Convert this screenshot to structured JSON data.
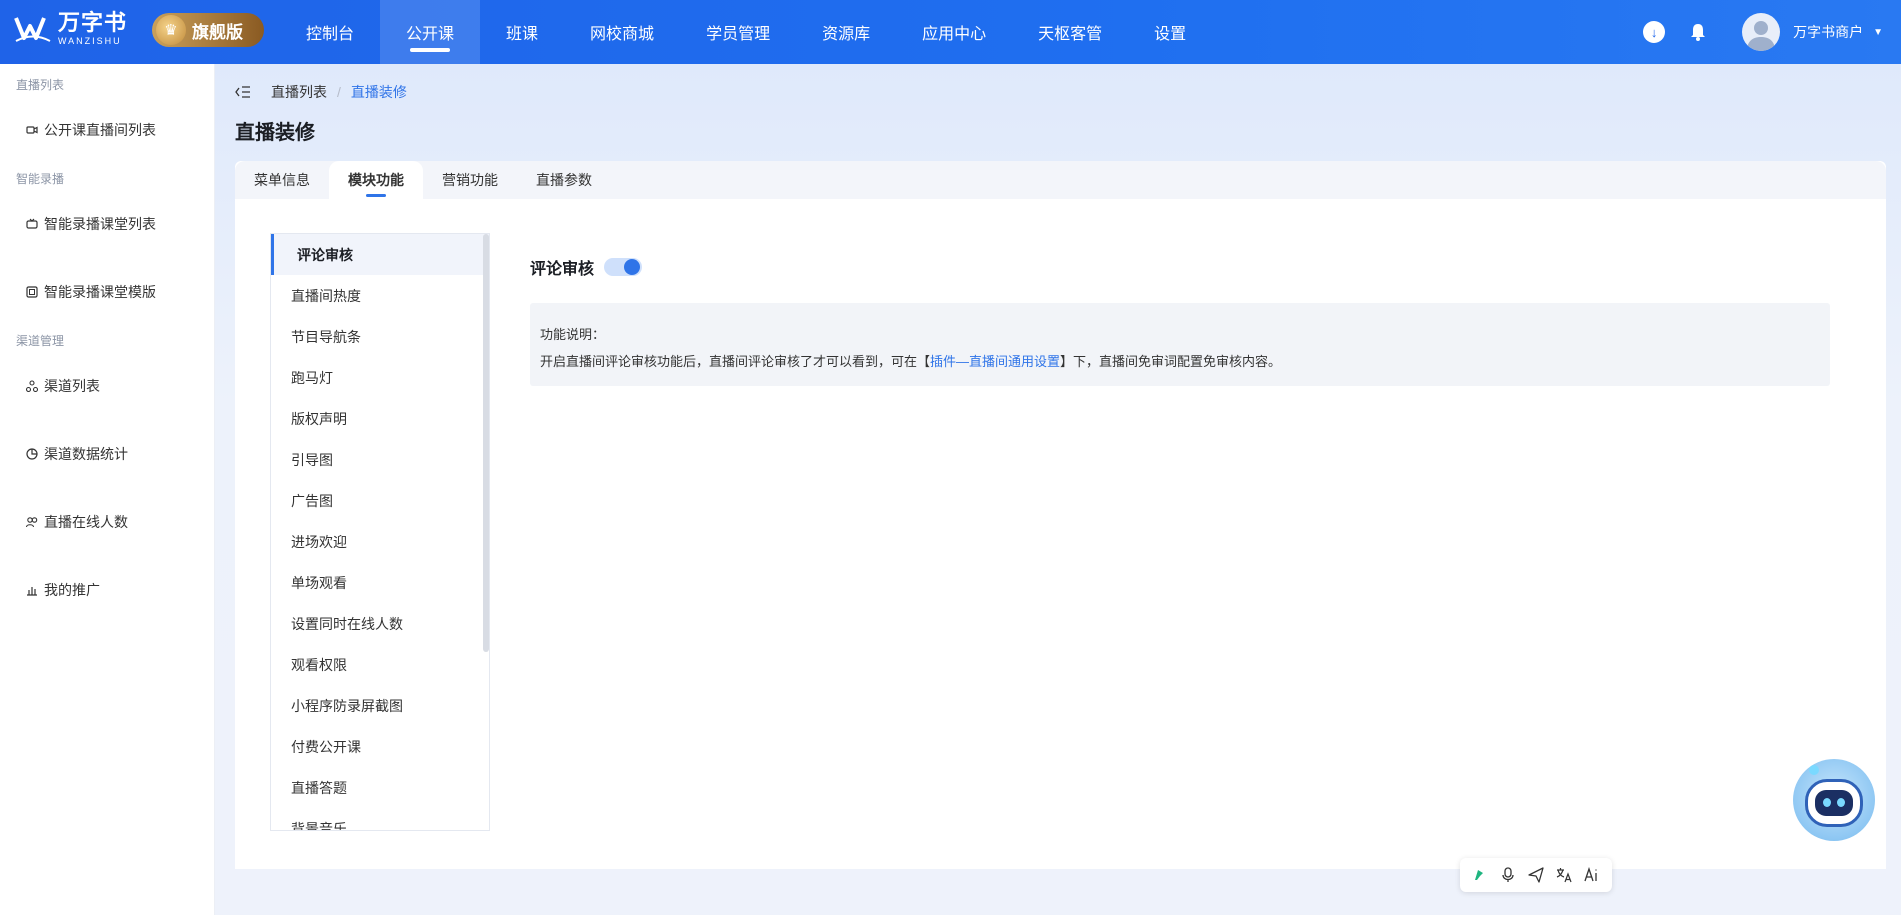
{
  "header": {
    "brand_cn": "万字书",
    "brand_en": "WANZISHU",
    "edition": "旗舰版",
    "nav": [
      {
        "label": "控制台"
      },
      {
        "label": "公开课",
        "active": true
      },
      {
        "label": "班课"
      },
      {
        "label": "网校商城"
      },
      {
        "label": "学员管理"
      },
      {
        "label": "资源库"
      },
      {
        "label": "应用中心"
      },
      {
        "label": "天枢客管"
      },
      {
        "label": "设置"
      }
    ],
    "user_name": "万字书商户"
  },
  "sidebar": {
    "groups": [
      {
        "title": "直播列表",
        "items": [
          {
            "label": "公开课直播间列表",
            "icon": "video-icon"
          }
        ]
      },
      {
        "title": "智能录播",
        "items": [
          {
            "label": "智能录播课堂列表",
            "icon": "tv-icon"
          },
          {
            "label": "智能录播课堂模版",
            "icon": "template-icon"
          }
        ]
      },
      {
        "title": "渠道管理",
        "items": [
          {
            "label": "渠道列表",
            "icon": "channel-icon"
          },
          {
            "label": "渠道数据统计",
            "icon": "pie-chart-icon"
          },
          {
            "label": "直播在线人数",
            "icon": "users-icon"
          },
          {
            "label": "我的推广",
            "icon": "promotion-icon"
          }
        ]
      }
    ]
  },
  "breadcrumb": {
    "items": [
      "直播列表",
      "直播装修"
    ],
    "separator": "/"
  },
  "page": {
    "title": "直播装修",
    "tabs": [
      "菜单信息",
      "模块功能",
      "营销功能",
      "直播参数"
    ],
    "active_tab": 1,
    "modules": [
      "评论审核",
      "直播间热度",
      "节目导航条",
      "跑马灯",
      "版权声明",
      "引导图",
      "广告图",
      "进场欢迎",
      "单场观看",
      "设置同时在线人数",
      "观看权限",
      "小程序防录屏截图",
      "付费公开课",
      "直播答题",
      "背景音乐"
    ],
    "active_module": 0,
    "setting": {
      "title": "评论审核",
      "enabled": true
    },
    "description": {
      "heading": "功能说明：",
      "text_before": "开启直播间评论审核功能后，直播间评论审核了才可以看到，可在【",
      "link": "插件—直播间通用设置",
      "text_after": "】下，直播间免审词配置免审核内容。"
    }
  },
  "colors": {
    "primary": "#2f74e8",
    "topbar": "#1f66ea",
    "edition_gold": "#b5843f"
  }
}
